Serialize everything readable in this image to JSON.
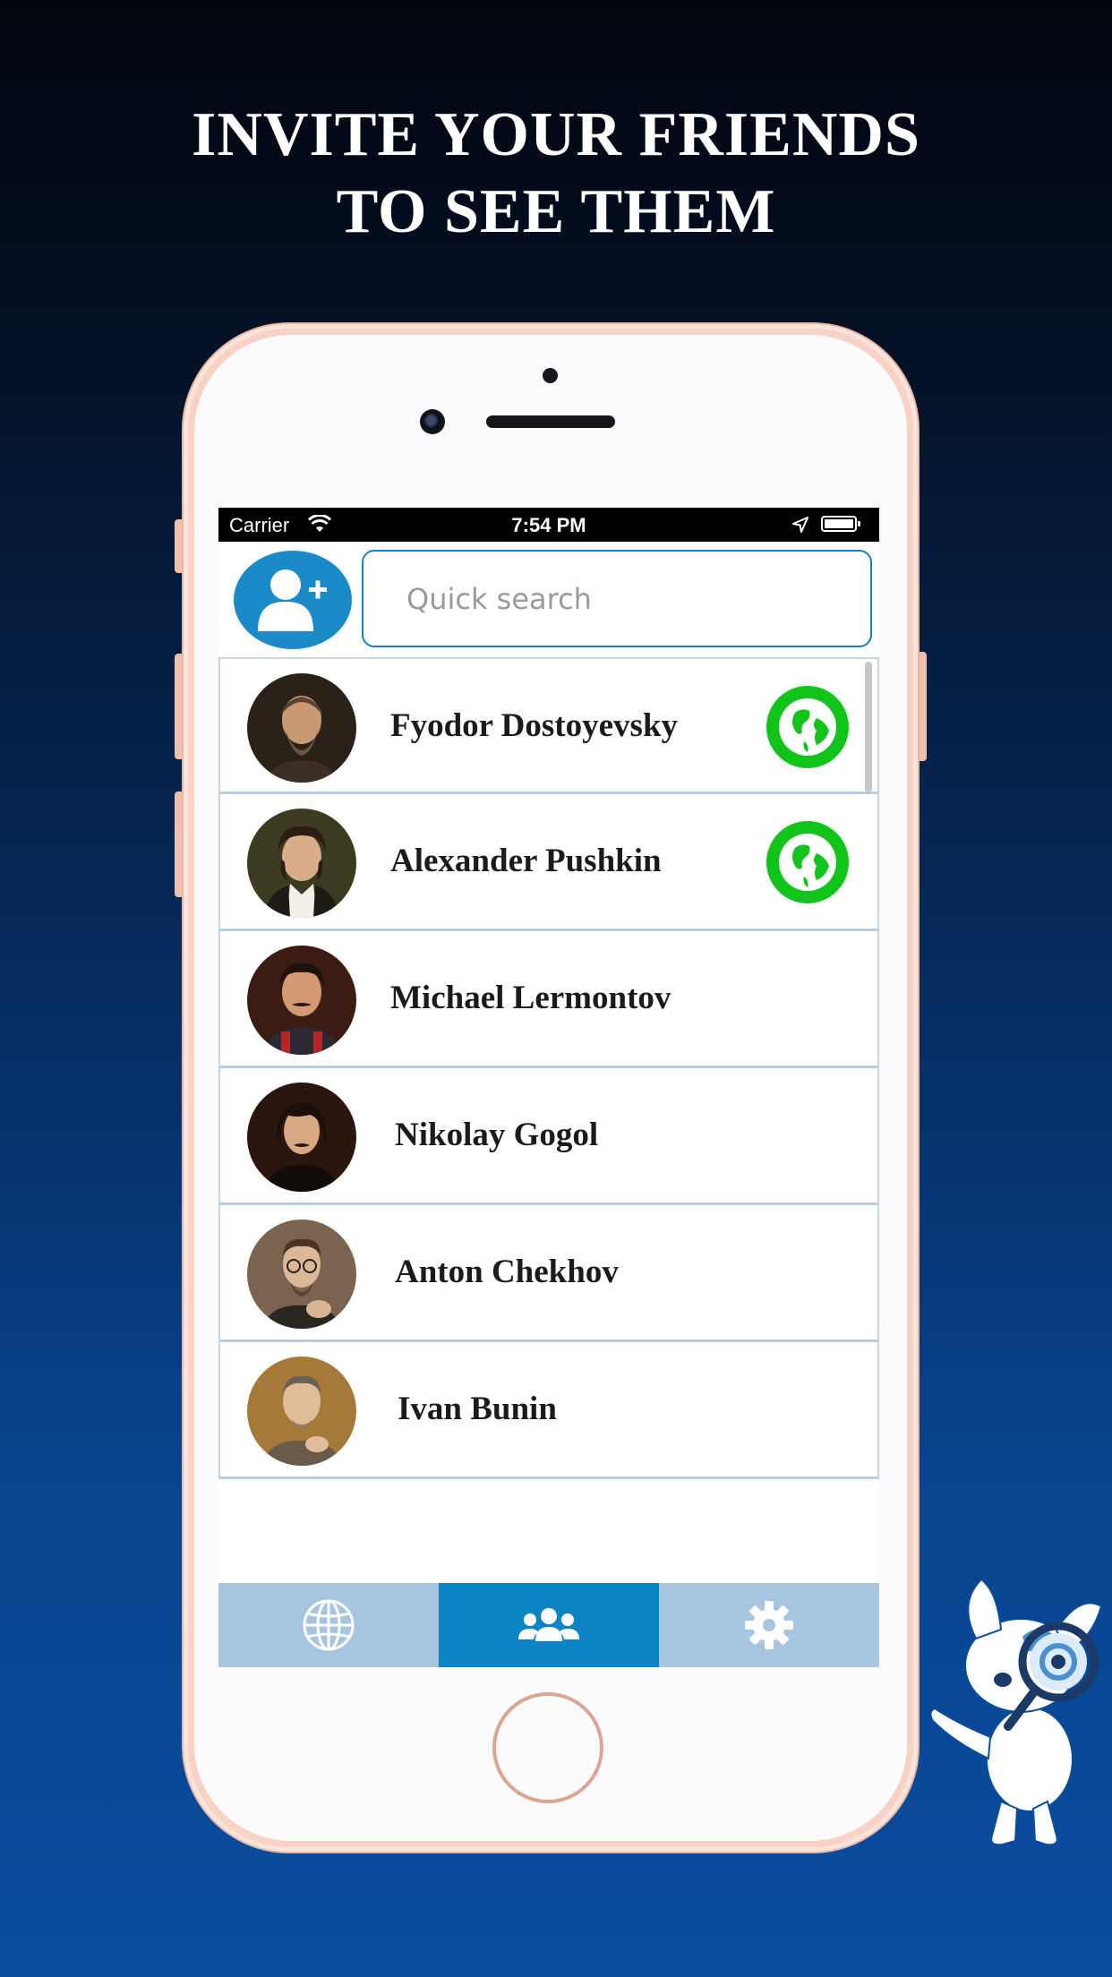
{
  "headline": {
    "line1": "INVITE YOUR FRIENDS",
    "line2": "TO SEE THEM"
  },
  "status_bar": {
    "carrier": "Carrier",
    "time": "7:54 PM"
  },
  "search": {
    "placeholder": "Quick search"
  },
  "contacts": [
    {
      "name": "Fyodor Dostoyevsky",
      "has_globe_badge": true
    },
    {
      "name": "Alexander Pushkin",
      "has_globe_badge": true
    },
    {
      "name": "Michael Lermontov",
      "has_globe_badge": false
    },
    {
      "name": "Nikolay Gogol",
      "has_globe_badge": false
    },
    {
      "name": "Anton Chekhov",
      "has_globe_badge": false
    },
    {
      "name": "Ivan Bunin",
      "has_globe_badge": false
    }
  ],
  "tab_bar": {
    "tabs": [
      {
        "icon": "globe-icon",
        "active": false
      },
      {
        "icon": "people-icon",
        "active": true
      },
      {
        "icon": "gear-icon",
        "active": false
      }
    ]
  },
  "colors": {
    "accent": "#0b84c3",
    "tab_bar": "#a8c5e0",
    "online_badge": "#11c41a",
    "phone_frame": "#f7d2c5"
  }
}
